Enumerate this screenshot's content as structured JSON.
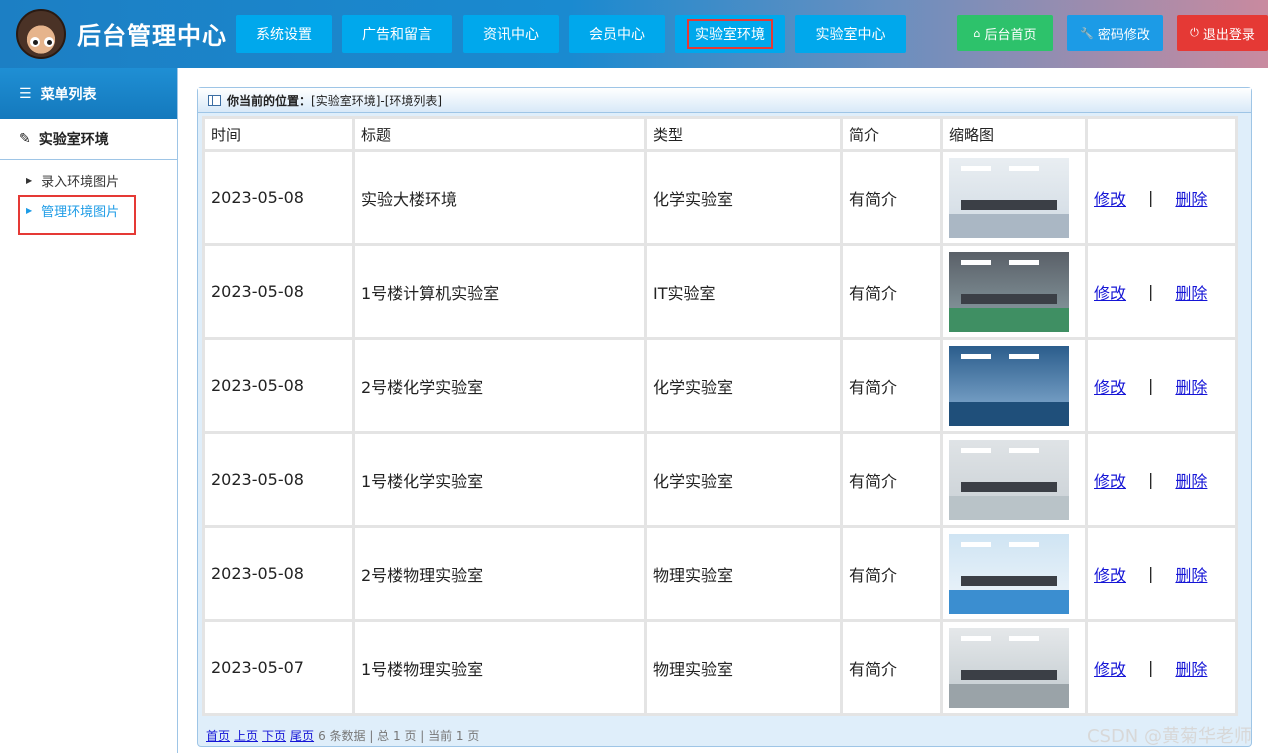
{
  "header": {
    "title": "后台管理中心",
    "nav": [
      "系统设置",
      "广告和留言",
      "资讯中心",
      "会员中心",
      "实验室环境",
      "实验室中心"
    ],
    "active_nav": "实验室环境",
    "right_buttons": {
      "home": "后台首页",
      "password": "密码修改",
      "logout": "退出登录"
    }
  },
  "sidebar": {
    "menu_title": "菜单列表",
    "group": "实验室环境",
    "items": [
      "录入环境图片",
      "管理环境图片"
    ],
    "active_item": "管理环境图片"
  },
  "main": {
    "breadcrumb_label": "你当前的位置：",
    "breadcrumb_path": "[实验室环境]-[环境列表]",
    "columns": [
      "时间",
      "标题",
      "类型",
      "简介",
      "缩略图",
      ""
    ],
    "rows": [
      {
        "date": "2023-05-08",
        "title": "实验大楼环境",
        "type": "化学实验室",
        "intro": "有简介",
        "thumb": "lab-white"
      },
      {
        "date": "2023-05-08",
        "title": "1号楼计算机实验室",
        "type": "IT实验室",
        "intro": "有简介",
        "thumb": "lab-green"
      },
      {
        "date": "2023-05-08",
        "title": "2号楼化学实验室",
        "type": "化学实验室",
        "intro": "有简介",
        "thumb": "lab-people"
      },
      {
        "date": "2023-05-08",
        "title": "1号楼化学实验室",
        "type": "化学实验室",
        "intro": "有简介",
        "thumb": "lab-grey"
      },
      {
        "date": "2023-05-08",
        "title": "2号楼物理实验室",
        "type": "物理实验室",
        "intro": "有简介",
        "thumb": "lab-blue"
      },
      {
        "date": "2023-05-07",
        "title": "1号楼物理实验室",
        "type": "物理实验室",
        "intro": "有简介",
        "thumb": "lab-office"
      }
    ],
    "edit_label": "修改",
    "separator": "|",
    "delete_label": "删除",
    "pager": {
      "first": "首页",
      "prev": "上页",
      "next": "下页",
      "last": "尾页",
      "info": "6 条数据 | 总 1 页 | 当前 1 页"
    }
  },
  "watermark": "CSDN @黄菊华老师",
  "colors": {
    "nav_button": "#00a8ec",
    "highlight_box": "#e53935",
    "home_button": "#2dc26b",
    "password_button": "#1c9be6",
    "logout_button": "#e53935",
    "link": "#1515d6"
  }
}
